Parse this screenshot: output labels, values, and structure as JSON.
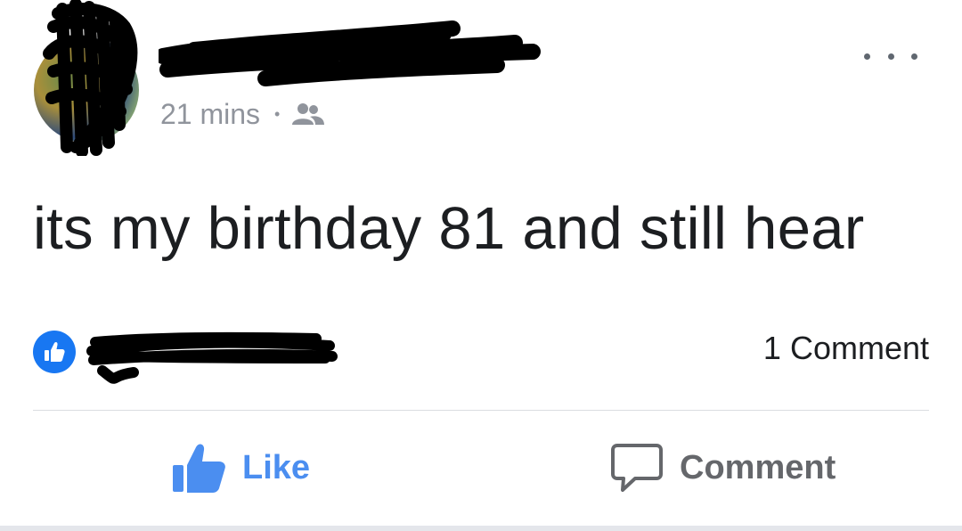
{
  "post": {
    "timestamp": "21 mins",
    "separator": "•",
    "audience_icon": "friends-icon",
    "body_text": "its my birthday 81 and still hear",
    "comment_count": "1 Comment"
  },
  "actions": {
    "like_label": "Like",
    "comment_label": "Comment"
  },
  "colors": {
    "like_blue": "#4b8ef0",
    "reaction_blue": "#1877f2",
    "meta_gray": "#90949c",
    "text_dark": "#1c1e21",
    "comment_gray": "#65676b"
  }
}
